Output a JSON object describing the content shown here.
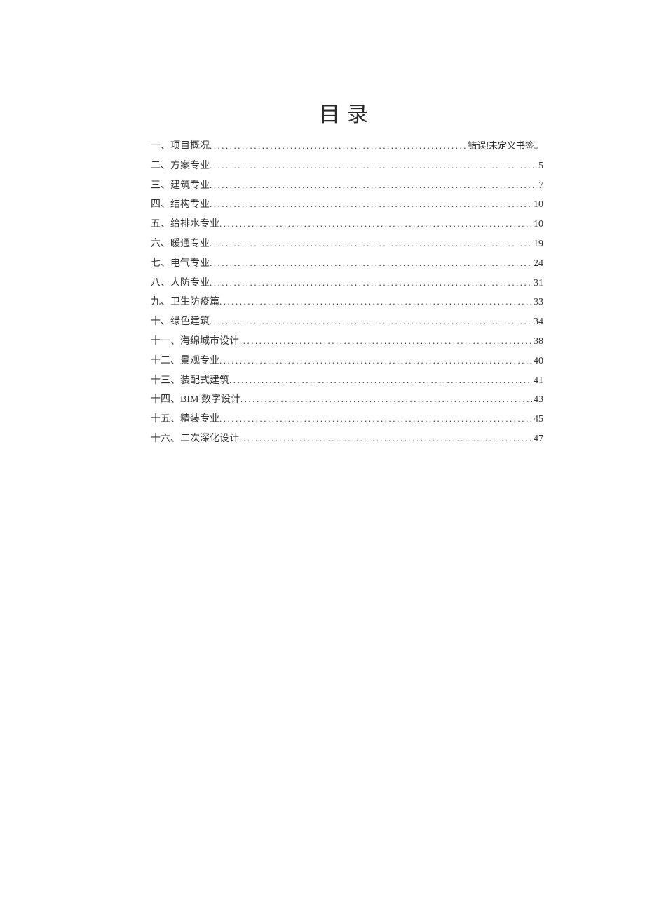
{
  "title": "目录",
  "toc": [
    {
      "label": "一、项目概况",
      "page": "错误!未定义书签。",
      "error": true
    },
    {
      "label": "二、方案专业",
      "page": "5",
      "error": false
    },
    {
      "label": "三、建筑专业",
      "page": "7",
      "error": false
    },
    {
      "label": "四、结构专业",
      "page": "10",
      "error": false
    },
    {
      "label": "五、给排水专业",
      "page": "10",
      "error": false
    },
    {
      "label": "六、暖通专业",
      "page": "19",
      "error": false
    },
    {
      "label": "七、电气专业",
      "page": "24",
      "error": false
    },
    {
      "label": "八、人防专业",
      "page": "31",
      "error": false
    },
    {
      "label": "九、卫生防疫篇",
      "page": "33",
      "error": false
    },
    {
      "label": "十、绿色建筑",
      "page": "34",
      "error": false
    },
    {
      "label": "十一、海绵城市设计",
      "page": "38",
      "error": false
    },
    {
      "label": "十二、景观专业",
      "page": "40",
      "error": false
    },
    {
      "label": "十三、装配式建筑",
      "page": "41",
      "error": false
    },
    {
      "label": "十四、BIM 数字设计",
      "page": "43",
      "error": false
    },
    {
      "label": "十五、精装专业",
      "page": "45",
      "error": false
    },
    {
      "label": "十六、二次深化设计",
      "page": "47",
      "error": false
    }
  ]
}
